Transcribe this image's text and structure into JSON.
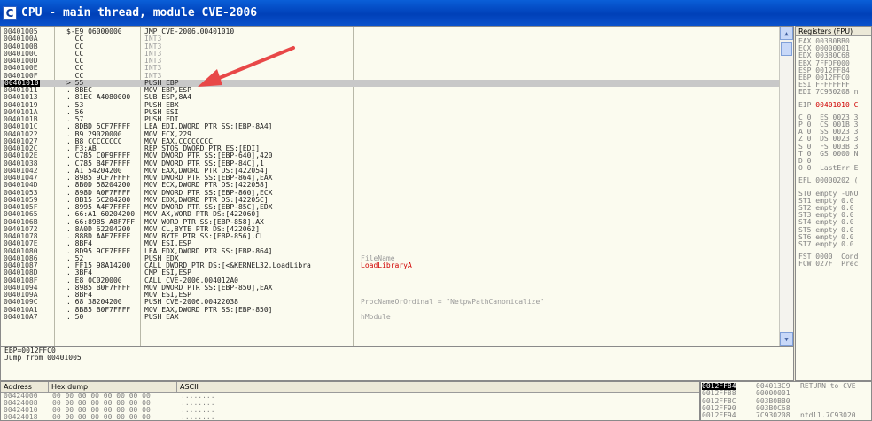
{
  "window": {
    "title": "CPU - main thread, module CVE-2006",
    "icon_letter": "C"
  },
  "disasm": {
    "rows": [
      {
        "addr": "00401005",
        "bytes": "$-E9 06000000",
        "cmd": "JMP CVE-2006.00401010",
        "cmt": "",
        "kind": ""
      },
      {
        "addr": "0040100A",
        "bytes": "  CC",
        "cmd": "INT3",
        "cmt": "",
        "kind": "gray"
      },
      {
        "addr": "0040100B",
        "bytes": "  CC",
        "cmd": "INT3",
        "cmt": "",
        "kind": "gray"
      },
      {
        "addr": "0040100C",
        "bytes": "  CC",
        "cmd": "INT3",
        "cmt": "",
        "kind": "gray"
      },
      {
        "addr": "0040100D",
        "bytes": "  CC",
        "cmd": "INT3",
        "cmt": "",
        "kind": "gray"
      },
      {
        "addr": "0040100E",
        "bytes": "  CC",
        "cmd": "INT3",
        "cmt": "",
        "kind": "gray"
      },
      {
        "addr": "0040100F",
        "bytes": "  CC",
        "cmd": "INT3",
        "cmt": "",
        "kind": "gray"
      },
      {
        "addr": "00401010",
        "bytes": "> 55",
        "cmd": "PUSH EBP",
        "cmt": "",
        "kind": "sel"
      },
      {
        "addr": "00401011",
        "bytes": ". 8BEC",
        "cmd": "MOV EBP,ESP",
        "cmt": "",
        "kind": ""
      },
      {
        "addr": "00401013",
        "bytes": ". 81EC A4080000",
        "cmd": "SUB ESP,8A4",
        "cmt": "",
        "kind": ""
      },
      {
        "addr": "00401019",
        "bytes": ". 53",
        "cmd": "PUSH EBX",
        "cmt": "",
        "kind": ""
      },
      {
        "addr": "0040101A",
        "bytes": ". 56",
        "cmd": "PUSH ESI",
        "cmt": "",
        "kind": ""
      },
      {
        "addr": "0040101B",
        "bytes": ". 57",
        "cmd": "PUSH EDI",
        "cmt": "",
        "kind": ""
      },
      {
        "addr": "0040101C",
        "bytes": ". 8DBD 5CF7FFFF",
        "cmd": "LEA EDI,DWORD PTR SS:[EBP-8A4]",
        "cmt": "",
        "kind": ""
      },
      {
        "addr": "00401022",
        "bytes": ". B9 29020000",
        "cmd": "MOV ECX,229",
        "cmt": "",
        "kind": ""
      },
      {
        "addr": "00401027",
        "bytes": ". B8 CCCCCCCC",
        "cmd": "MOV EAX,CCCCCCCC",
        "cmt": "",
        "kind": ""
      },
      {
        "addr": "0040102C",
        "bytes": ". F3:AB",
        "cmd": "REP STOS DWORD PTR ES:[EDI]",
        "cmt": "",
        "kind": ""
      },
      {
        "addr": "0040102E",
        "bytes": ". C785 C0F9FFFF",
        "cmd": "MOV DWORD PTR SS:[EBP-640],420",
        "cmt": "",
        "kind": ""
      },
      {
        "addr": "00401038",
        "bytes": ". C785 B4F7FFFF",
        "cmd": "MOV DWORD PTR SS:[EBP-84C],1",
        "cmt": "",
        "kind": ""
      },
      {
        "addr": "00401042",
        "bytes": ". A1 54204200",
        "cmd": "MOV EAX,DWORD PTR DS:[422054]",
        "cmt": "",
        "kind": ""
      },
      {
        "addr": "00401047",
        "bytes": ". 8985 9CF7FFFF",
        "cmd": "MOV DWORD PTR SS:[EBP-864],EAX",
        "cmt": "",
        "kind": ""
      },
      {
        "addr": "0040104D",
        "bytes": ". 8B0D 58204200",
        "cmd": "MOV ECX,DWORD PTR DS:[422058]",
        "cmt": "",
        "kind": ""
      },
      {
        "addr": "00401053",
        "bytes": ". 898D A0F7FFFF",
        "cmd": "MOV DWORD PTR SS:[EBP-860],ECX",
        "cmt": "",
        "kind": ""
      },
      {
        "addr": "00401059",
        "bytes": ". 8B15 5C204200",
        "cmd": "MOV EDX,DWORD PTR DS:[42205C]",
        "cmt": "",
        "kind": ""
      },
      {
        "addr": "0040105F",
        "bytes": ". 8995 A4F7FFFF",
        "cmd": "MOV DWORD PTR SS:[EBP-85C],EDX",
        "cmt": "",
        "kind": ""
      },
      {
        "addr": "00401065",
        "bytes": ". 66:A1 60204200",
        "cmd": "MOV AX,WORD PTR DS:[422060]",
        "cmt": "",
        "kind": ""
      },
      {
        "addr": "0040106B",
        "bytes": ". 66:8985 A8F7FF",
        "cmd": "MOV WORD PTR SS:[EBP-858],AX",
        "cmt": "",
        "kind": ""
      },
      {
        "addr": "00401072",
        "bytes": ". 8A0D 62204200",
        "cmd": "MOV CL,BYTE PTR DS:[422062]",
        "cmt": "",
        "kind": ""
      },
      {
        "addr": "00401078",
        "bytes": ". 888D AAF7FFFF",
        "cmd": "MOV BYTE PTR SS:[EBP-856],CL",
        "cmt": "",
        "kind": ""
      },
      {
        "addr": "0040107E",
        "bytes": ". 8BF4",
        "cmd": "MOV ESI,ESP",
        "cmt": "",
        "kind": ""
      },
      {
        "addr": "00401080",
        "bytes": ". 8D95 9CF7FFFF",
        "cmd": "LEA EDX,DWORD PTR SS:[EBP-864]",
        "cmt": "",
        "kind": ""
      },
      {
        "addr": "00401086",
        "bytes": ". 52",
        "cmd": "PUSH EDX",
        "cmt": "FileName",
        "kind": "cmtgray"
      },
      {
        "addr": "00401087",
        "bytes": ". FF15 98A14200",
        "cmd": "CALL DWORD PTR DS:[<&KERNEL32.LoadLibra",
        "cmt": "LoadLibraryA",
        "kind": "cmtred"
      },
      {
        "addr": "0040108D",
        "bytes": ". 3BF4",
        "cmd": "CMP ESI,ESP",
        "cmt": "",
        "kind": ""
      },
      {
        "addr": "0040108F",
        "bytes": ". E8 0C020000",
        "cmd": "CALL CVE-2006.004012A0",
        "cmt": "",
        "kind": ""
      },
      {
        "addr": "00401094",
        "bytes": ". 8985 B0F7FFFF",
        "cmd": "MOV DWORD PTR SS:[EBP-850],EAX",
        "cmt": "",
        "kind": ""
      },
      {
        "addr": "0040109A",
        "bytes": ". 8BF4",
        "cmd": "MOV ESI,ESP",
        "cmt": "",
        "kind": ""
      },
      {
        "addr": "0040109C",
        "bytes": ". 68 38204200",
        "cmd": "PUSH CVE-2006.00422038",
        "cmt": "ProcNameOrOrdinal = \"NetpwPathCanonicalize\"",
        "kind": "cmtmix"
      },
      {
        "addr": "004010A1",
        "bytes": ". 8B85 B0F7FFFF",
        "cmd": "MOV EAX,DWORD PTR SS:[EBP-850]",
        "cmt": "",
        "kind": ""
      },
      {
        "addr": "004010A7",
        "bytes": ". 50",
        "cmd": "PUSH EAX",
        "cmt": "hModule",
        "kind": "cmtgray"
      }
    ]
  },
  "info": {
    "line1": "EBP=0012FFC0",
    "line2": "Jump from 00401005"
  },
  "registers": {
    "header": "Registers (FPU)",
    "lines": [
      "EAX 003B0BB0",
      "ECX 00000001",
      "EDX 003B0C68",
      "EBX 7FFDF000",
      "ESP 0012FF84",
      "EBP 0012FFC0",
      "ESI FFFFFFFF",
      "EDI 7C930208 n",
      "",
      "EIP|00401010 C",
      "",
      "C 0  ES 0023 3",
      "P 0  CS 001B 3",
      "A 0  SS 0023 3",
      "Z 0  DS 0023 3",
      "S 0  FS 003B 3",
      "T 0  GS 0000 N",
      "D 0",
      "O 0  LastErr E",
      "",
      "EFL 00000202 (",
      "",
      "ST0 empty -UNO",
      "ST1 empty 0.0",
      "ST2 empty 0.0",
      "ST3 empty 0.0",
      "ST4 empty 0.0",
      "ST5 empty 0.0",
      "ST6 empty 0.0",
      "ST7 empty 0.0",
      "",
      "FST 0000  Cond",
      "FCW 027F  Prec"
    ]
  },
  "dump": {
    "headers": [
      "Address",
      "Hex dump",
      "ASCII"
    ],
    "rows": [
      {
        "addr": "00424000",
        "hex": "00 00 00 00 00 00 00 00",
        "ascii": "........"
      },
      {
        "addr": "00424008",
        "hex": "00 00 00 00 00 00 00 00",
        "ascii": "........"
      },
      {
        "addr": "00424010",
        "hex": "00 00 00 00 00 00 00 00",
        "ascii": "........"
      },
      {
        "addr": "00424018",
        "hex": "00 00 00 00 00 00 00 00",
        "ascii": "........"
      }
    ]
  },
  "stack": {
    "rows": [
      {
        "addr": "0012FF84",
        "val": "004013C9",
        "cmt": "RETURN to CVE"
      },
      {
        "addr": "0012FF88",
        "val": "00000001",
        "cmt": ""
      },
      {
        "addr": "0012FF8C",
        "val": "003B0BB0",
        "cmt": ""
      },
      {
        "addr": "0012FF90",
        "val": "003B0C68",
        "cmt": ""
      },
      {
        "addr": "0012FF94",
        "val": "7C930208",
        "cmt": "ntdll.7C93020"
      }
    ]
  },
  "colors": {
    "title_bar": "#0a52cc",
    "selection": "#c8c8c8",
    "comment_red": "#d00000",
    "annotation_arrow": "#e84848"
  }
}
